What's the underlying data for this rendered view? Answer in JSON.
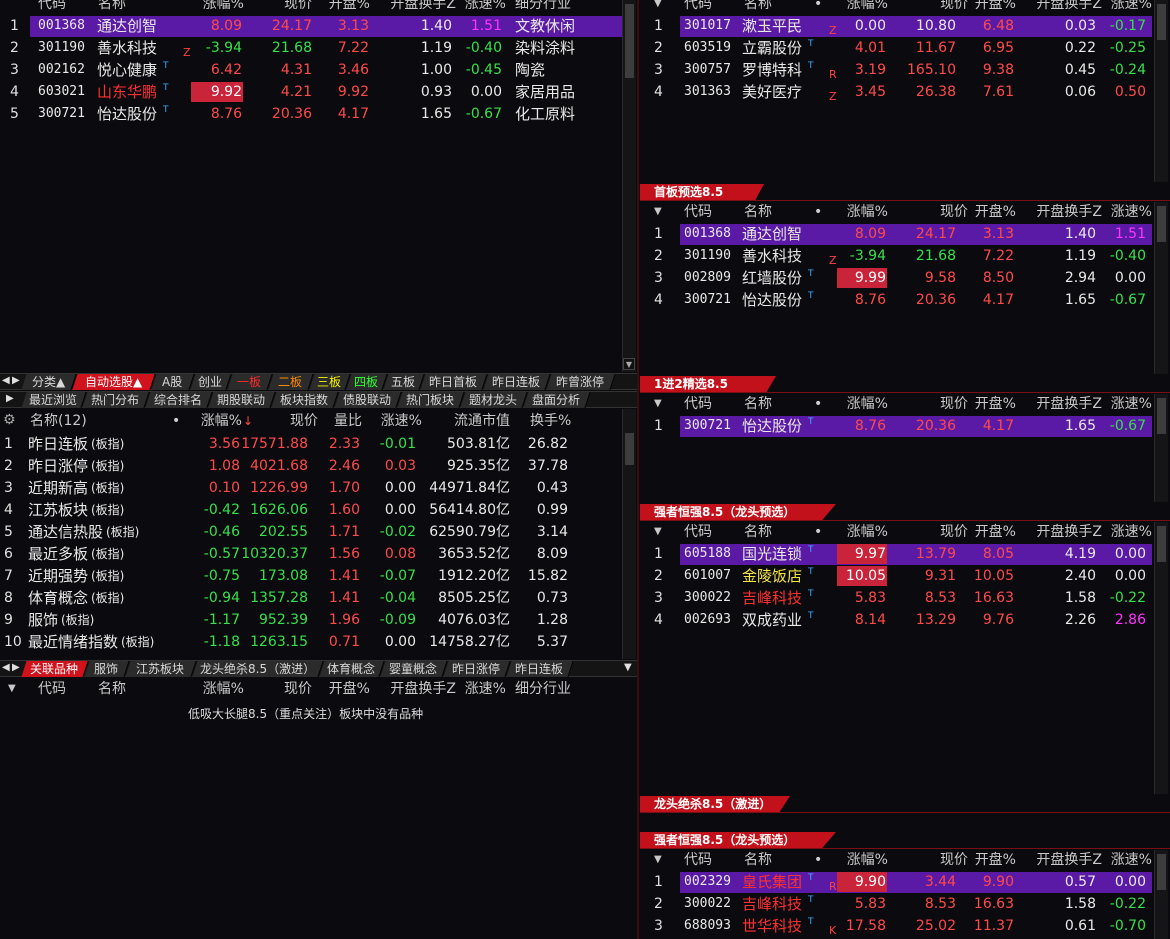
{
  "colors": {
    "accent_red": "#c2111b",
    "highlight_purple": "#5a1aa6",
    "up_red": "#ff4a4a",
    "down_green": "#36e04a"
  },
  "icons": {
    "settings": "gear-icon",
    "collapse": "triangle-down-icon",
    "tab_left": "arrow-left-icon",
    "tab_right": "arrow-right-icon",
    "scroll_down": "scroll-down-icon"
  },
  "top_left": {
    "headers": [
      "代码",
      "名称",
      "涨幅%",
      "现价",
      "开盘%",
      "开盘换手Z",
      "涨速%",
      "细分行业"
    ],
    "rows": [
      {
        "idx": "1",
        "code": "001368",
        "name": "通达创智",
        "sup": "",
        "tag": "",
        "chg": "8.09",
        "price": "24.17",
        "open": "3.13",
        "turn": "1.40",
        "speed": "1.51",
        "industry": "文教休闲",
        "hl": true,
        "box": false,
        "chgc": "red",
        "pricec": "red",
        "openc": "red",
        "speedc": "mag",
        "namec": "white"
      },
      {
        "idx": "2",
        "code": "301190",
        "name": "善水科技",
        "sup": "",
        "tag": "Z",
        "chg": "-3.94",
        "price": "21.68",
        "open": "7.22",
        "turn": "1.19",
        "speed": "-0.40",
        "industry": "染料涂料",
        "hl": false,
        "box": false,
        "chgc": "green",
        "pricec": "green",
        "openc": "red",
        "speedc": "green",
        "namec": "white"
      },
      {
        "idx": "3",
        "code": "002162",
        "name": "悦心健康",
        "sup": "T",
        "tag": "",
        "chg": "6.42",
        "price": "4.31",
        "open": "3.46",
        "turn": "1.00",
        "speed": "-0.45",
        "industry": "陶瓷",
        "hl": false,
        "box": false,
        "chgc": "red",
        "pricec": "red",
        "openc": "red",
        "speedc": "green",
        "namec": "white"
      },
      {
        "idx": "4",
        "code": "603021",
        "name": "山东华鹏",
        "sup": "T",
        "tag": "",
        "chg": "9.92",
        "price": "4.21",
        "open": "9.92",
        "turn": "0.93",
        "speed": "0.00",
        "industry": "家居用品",
        "hl": false,
        "box": true,
        "chgc": "red",
        "pricec": "red",
        "openc": "red",
        "speedc": "white",
        "namec": "redname"
      },
      {
        "idx": "5",
        "code": "300721",
        "name": "怡达股份",
        "sup": "T",
        "tag": "",
        "chg": "8.76",
        "price": "20.36",
        "open": "4.17",
        "turn": "1.65",
        "speed": "-0.67",
        "industry": "化工原料",
        "hl": false,
        "box": false,
        "chgc": "red",
        "pricec": "red",
        "openc": "red",
        "speedc": "green",
        "namec": "white"
      }
    ]
  },
  "tabs_row1": [
    "分类▲",
    "自动选股▲",
    "A股",
    "创业",
    "一板",
    "二板",
    "三板",
    "四板",
    "五板",
    "昨日首板",
    "昨日连板",
    "昨曾涨停"
  ],
  "tabs_row2": [
    "最近浏览",
    "热门分布",
    "综合排名",
    "期股联动",
    "板块指数",
    "债股联动",
    "热门板块",
    "题材龙头",
    "盘面分析"
  ],
  "index_table": {
    "headers": [
      "名称(12)",
      "涨幅%",
      "现价",
      "量比",
      "涨速%",
      "流通市值",
      "换手%"
    ],
    "sort_arrow": "↓",
    "rows": [
      {
        "idx": "1",
        "name": "昨日连板",
        "suffix": "(板指)",
        "chg": "3.56",
        "price": "17571.88",
        "ratio": "2.33",
        "speed": "-0.01",
        "cap": "503.81亿",
        "turn": "26.82",
        "chgc": "red",
        "speedc": "green"
      },
      {
        "idx": "2",
        "name": "昨日涨停",
        "suffix": "(板指)",
        "chg": "1.08",
        "price": "4021.68",
        "ratio": "2.46",
        "speed": "0.03",
        "cap": "925.35亿",
        "turn": "37.78",
        "chgc": "red",
        "speedc": "red"
      },
      {
        "idx": "3",
        "name": "近期新高",
        "suffix": "(板指)",
        "chg": "0.10",
        "price": "1226.99",
        "ratio": "1.70",
        "speed": "0.00",
        "cap": "44971.84亿",
        "turn": "0.43",
        "chgc": "red",
        "speedc": "white"
      },
      {
        "idx": "4",
        "name": "江苏板块",
        "suffix": "(板指)",
        "chg": "-0.42",
        "price": "1626.06",
        "ratio": "1.60",
        "speed": "0.00",
        "cap": "56414.80亿",
        "turn": "0.99",
        "chgc": "green",
        "speedc": "white"
      },
      {
        "idx": "5",
        "name": "通达信热股",
        "suffix": "(板指)",
        "chg": "-0.46",
        "price": "202.55",
        "ratio": "1.71",
        "speed": "-0.02",
        "cap": "62590.79亿",
        "turn": "3.14",
        "chgc": "green",
        "speedc": "green"
      },
      {
        "idx": "6",
        "name": "最近多板",
        "suffix": "(板指)",
        "chg": "-0.57",
        "price": "10320.37",
        "ratio": "1.56",
        "speed": "0.08",
        "cap": "3653.52亿",
        "turn": "8.09",
        "chgc": "green",
        "speedc": "red"
      },
      {
        "idx": "7",
        "name": "近期强势",
        "suffix": "(板指)",
        "chg": "-0.75",
        "price": "173.08",
        "ratio": "1.41",
        "speed": "-0.07",
        "cap": "1912.20亿",
        "turn": "15.82",
        "chgc": "green",
        "speedc": "green"
      },
      {
        "idx": "8",
        "name": "体育概念",
        "suffix": "(板指)",
        "chg": "-0.94",
        "price": "1357.28",
        "ratio": "1.41",
        "speed": "-0.04",
        "cap": "8505.25亿",
        "turn": "0.73",
        "chgc": "green",
        "speedc": "green"
      },
      {
        "idx": "9",
        "name": "服饰",
        "suffix": "(板指)",
        "chg": "-1.17",
        "price": "952.39",
        "ratio": "1.96",
        "speed": "-0.09",
        "cap": "4076.03亿",
        "turn": "1.28",
        "chgc": "green",
        "speedc": "green"
      },
      {
        "idx": "10",
        "name": "最近情绪指数",
        "suffix": "(板指)",
        "chg": "-1.18",
        "price": "1263.15",
        "ratio": "0.71",
        "speed": "0.00",
        "cap": "14758.27亿",
        "turn": "5.37",
        "chgc": "green",
        "speedc": "white"
      }
    ]
  },
  "tabs_row3": [
    "关联品种",
    "服饰",
    "江苏板块",
    "龙头绝杀8.5（激进）",
    "体育概念",
    "婴童概念",
    "昨日涨停",
    "昨日连板"
  ],
  "related": {
    "headers": [
      "代码",
      "名称",
      "涨幅%",
      "现价",
      "开盘%",
      "开盘换手Z",
      "涨速%",
      "细分行业"
    ],
    "empty_msg": "低吸大长腿8.5（重点关注）板块中没有品种"
  },
  "right_headers": [
    "代码",
    "名称",
    "涨幅%",
    "现价",
    "开盘%",
    "开盘换手Z",
    "涨速%"
  ],
  "right_top": {
    "rows": [
      {
        "idx": "1",
        "code": "301017",
        "name": "漱玉平民",
        "sup": "",
        "tag": "Z",
        "chg": "0.00",
        "price": "10.80",
        "open": "6.48",
        "turn": "0.03",
        "speed": "-0.17",
        "hl": true,
        "box": false,
        "chgc": "white",
        "pricec": "white",
        "openc": "red",
        "speedc": "green",
        "namec": "white"
      },
      {
        "idx": "2",
        "code": "603519",
        "name": "立霸股份",
        "sup": "T",
        "tag": "",
        "chg": "4.01",
        "price": "11.67",
        "open": "6.95",
        "turn": "0.22",
        "speed": "-0.25",
        "hl": false,
        "box": false,
        "chgc": "red",
        "pricec": "red",
        "openc": "red",
        "speedc": "green",
        "namec": "white"
      },
      {
        "idx": "3",
        "code": "300757",
        "name": "罗博特科",
        "sup": "T",
        "tag": "R",
        "chg": "3.19",
        "price": "165.10",
        "open": "9.38",
        "turn": "0.45",
        "speed": "-0.24",
        "hl": false,
        "box": false,
        "chgc": "red",
        "pricec": "red",
        "openc": "red",
        "speedc": "green",
        "namec": "white"
      },
      {
        "idx": "4",
        "code": "301363",
        "name": "美好医疗",
        "sup": "",
        "tag": "Z",
        "chg": "3.45",
        "price": "26.38",
        "open": "7.61",
        "turn": "0.06",
        "speed": "0.50",
        "hl": false,
        "box": false,
        "chgc": "red",
        "pricec": "red",
        "openc": "red",
        "speedc": "red",
        "namec": "white"
      }
    ]
  },
  "sec1": {
    "title": "首板预选8.5",
    "rows": [
      {
        "idx": "1",
        "code": "001368",
        "name": "通达创智",
        "sup": "",
        "tag": "",
        "chg": "8.09",
        "price": "24.17",
        "open": "3.13",
        "turn": "1.40",
        "speed": "1.51",
        "hl": true,
        "box": false,
        "chgc": "red",
        "pricec": "red",
        "openc": "red",
        "speedc": "mag",
        "namec": "white"
      },
      {
        "idx": "2",
        "code": "301190",
        "name": "善水科技",
        "sup": "",
        "tag": "Z",
        "chg": "-3.94",
        "price": "21.68",
        "open": "7.22",
        "turn": "1.19",
        "speed": "-0.40",
        "hl": false,
        "box": false,
        "chgc": "green",
        "pricec": "green",
        "openc": "red",
        "speedc": "green",
        "namec": "white"
      },
      {
        "idx": "3",
        "code": "002809",
        "name": "红墙股份",
        "sup": "T",
        "tag": "",
        "chg": "9.99",
        "price": "9.58",
        "open": "8.50",
        "turn": "2.94",
        "speed": "0.00",
        "hl": false,
        "box": true,
        "chgc": "red",
        "pricec": "red",
        "openc": "red",
        "speedc": "white",
        "namec": "white"
      },
      {
        "idx": "4",
        "code": "300721",
        "name": "怡达股份",
        "sup": "T",
        "tag": "",
        "chg": "8.76",
        "price": "20.36",
        "open": "4.17",
        "turn": "1.65",
        "speed": "-0.67",
        "hl": false,
        "box": false,
        "chgc": "red",
        "pricec": "red",
        "openc": "red",
        "speedc": "green",
        "namec": "white"
      }
    ]
  },
  "sec2": {
    "title": "1进2精选8.5",
    "rows": [
      {
        "idx": "1",
        "code": "300721",
        "name": "怡达股份",
        "sup": "T",
        "tag": "",
        "chg": "8.76",
        "price": "20.36",
        "open": "4.17",
        "turn": "1.65",
        "speed": "-0.67",
        "hl": true,
        "box": false,
        "chgc": "red",
        "pricec": "red",
        "openc": "red",
        "speedc": "green",
        "namec": "white"
      }
    ]
  },
  "sec3": {
    "title": "强者恒强8.5（龙头预选）",
    "rows": [
      {
        "idx": "1",
        "code": "605188",
        "name": "国光连锁",
        "sup": "T",
        "tag": "",
        "chg": "9.97",
        "price": "13.79",
        "open": "8.05",
        "turn": "4.19",
        "speed": "0.00",
        "hl": true,
        "box": true,
        "chgc": "red",
        "pricec": "red",
        "openc": "red",
        "speedc": "white",
        "namec": "white"
      },
      {
        "idx": "2",
        "code": "601007",
        "name": "金陵饭店",
        "sup": "T",
        "tag": "",
        "chg": "10.05",
        "price": "9.31",
        "open": "10.05",
        "turn": "2.40",
        "speed": "0.00",
        "hl": false,
        "box": true,
        "chgc": "red",
        "pricec": "red",
        "openc": "red",
        "speedc": "white",
        "namec": "yellow"
      },
      {
        "idx": "3",
        "code": "300022",
        "name": "吉峰科技",
        "sup": "T",
        "tag": "",
        "chg": "5.83",
        "price": "8.53",
        "open": "16.63",
        "turn": "1.58",
        "speed": "-0.22",
        "hl": false,
        "box": false,
        "chgc": "red",
        "pricec": "red",
        "openc": "red",
        "speedc": "green",
        "namec": "redname"
      },
      {
        "idx": "4",
        "code": "002693",
        "name": "双成药业",
        "sup": "T",
        "tag": "",
        "chg": "8.14",
        "price": "13.29",
        "open": "9.76",
        "turn": "2.26",
        "speed": "2.86",
        "hl": false,
        "box": false,
        "chgc": "red",
        "pricec": "red",
        "openc": "red",
        "speedc": "mag",
        "namec": "white"
      }
    ]
  },
  "sec4": {
    "title": "龙头绝杀8.5（激进）"
  },
  "sec5": {
    "title": "强者恒强8.5（龙头预选）",
    "rows": [
      {
        "idx": "1",
        "code": "002329",
        "name": "皇氏集团",
        "sup": "T",
        "tag": "R",
        "chg": "9.90",
        "price": "3.44",
        "open": "9.90",
        "turn": "0.57",
        "speed": "0.00",
        "hl": true,
        "box": true,
        "chgc": "red",
        "pricec": "red",
        "openc": "red",
        "speedc": "white",
        "namec": "redname"
      },
      {
        "idx": "2",
        "code": "300022",
        "name": "吉峰科技",
        "sup": "T",
        "tag": "",
        "chg": "5.83",
        "price": "8.53",
        "open": "16.63",
        "turn": "1.58",
        "speed": "-0.22",
        "hl": false,
        "box": false,
        "chgc": "red",
        "pricec": "red",
        "openc": "red",
        "speedc": "green",
        "namec": "redname"
      },
      {
        "idx": "3",
        "code": "688093",
        "name": "世华科技",
        "sup": "T",
        "tag": "K",
        "chg": "17.58",
        "price": "25.02",
        "open": "11.37",
        "turn": "0.61",
        "speed": "-0.70",
        "hl": false,
        "box": false,
        "chgc": "red",
        "pricec": "red",
        "openc": "red",
        "speedc": "green",
        "namec": "redname"
      }
    ]
  }
}
